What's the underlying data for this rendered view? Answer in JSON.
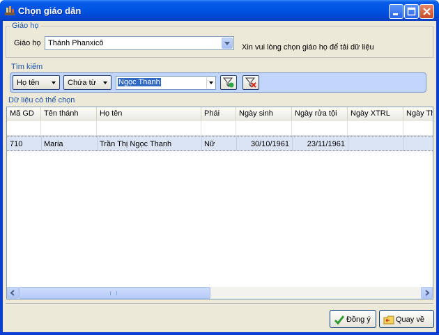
{
  "window": {
    "title": "Chọn giáo dân"
  },
  "parish_group": {
    "legend": "Giáo họ",
    "label": "Giáo họ",
    "selected": "Thánh Phanxicô",
    "hint": "Xin vui lòng chọn giáo họ để tải dữ liệu"
  },
  "search_group": {
    "legend": "Tìm kiếm",
    "field_dropdown": "Họ tên",
    "mode_dropdown": "Chứa từ",
    "search_value": "Ngọc Thanh",
    "filter_icon": "funnel-apply-icon",
    "clear_icon": "funnel-clear-icon"
  },
  "data_group": {
    "legend": "Dữ liệu có thể chọn",
    "columns": [
      "Mã GD",
      "Tên thánh",
      "Họ tên",
      "Phái",
      "Ngày sinh",
      "Ngày rửa tội",
      "Ngày XTRL",
      "Ngày Th"
    ],
    "rows": [
      [
        "710",
        "Maria",
        "Trần Thị Ngọc Thanh",
        "Nữ",
        "30/10/1961",
        "23/11/1961",
        "",
        ""
      ]
    ]
  },
  "buttons": {
    "ok_label": "Đồng ý",
    "back_label": "Quay về"
  },
  "colors": {
    "title_bar": "#0054e3",
    "client": "#ece9d8",
    "legend_text": "#1d52ab",
    "selected_row": "#dbe4f4",
    "search_bar": "#c2d6fb"
  }
}
